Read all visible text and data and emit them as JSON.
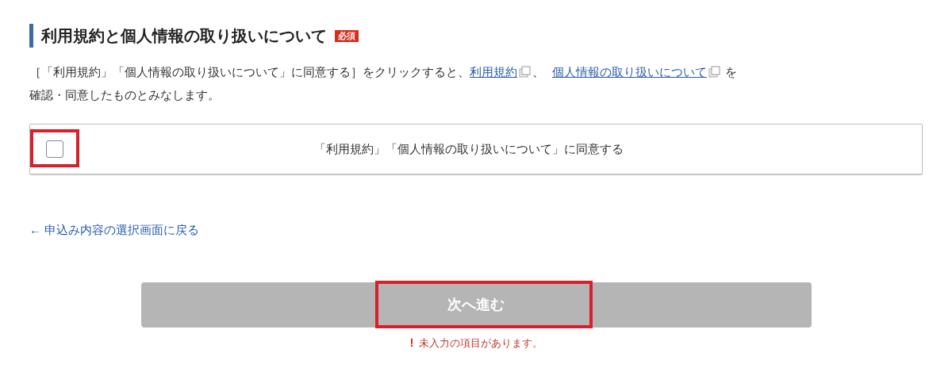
{
  "section": {
    "title": "利用規約と個人情報の取り扱いについて",
    "badge": "必須"
  },
  "intro": {
    "text_before": "［「利用規約」「個人情報の取り扱いについて」に同意する］をクリックすると、",
    "links": [
      "利用規約",
      "個人情報の取り扱いについて"
    ],
    "separator": "、",
    "text_after": "を",
    "second_line": "確認・同意したものとみなします。"
  },
  "agreement": {
    "label": "「利用規約」「個人情報の取り扱いについて」に同意する",
    "checked": false
  },
  "back_link": "← 申込み内容の選択画面に戻る",
  "next_button": {
    "label": "次へ進む",
    "disabled": true
  },
  "error": {
    "icon": "!",
    "message": "未入力の項目があります。"
  }
}
